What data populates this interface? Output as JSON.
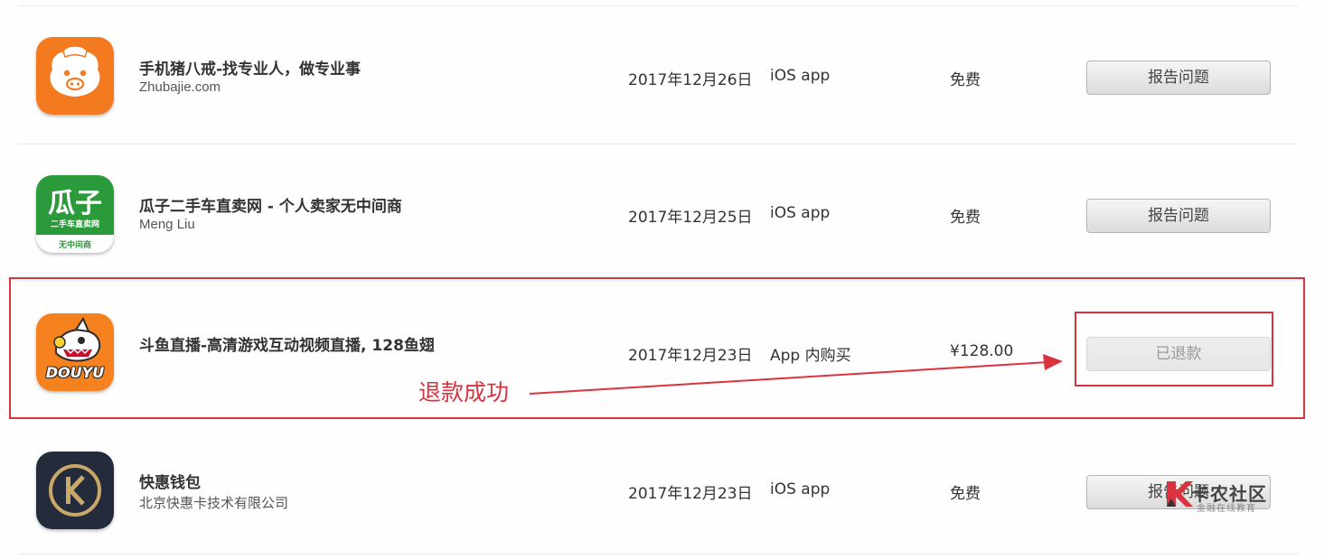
{
  "accent_color": "#d9333f",
  "rows": [
    {
      "icon": "zhubajie-pig-icon",
      "title": "手机猪八戒-找专业人，做专业事",
      "subtitle": "Zhubajie.com",
      "date": "2017年12月26日",
      "type": "iOS app",
      "price": "免费",
      "button": "报告问题"
    },
    {
      "icon": "guazi-logo-icon",
      "icon_text_main": "瓜子",
      "icon_text_line": "二手车直卖网",
      "icon_text_band": "无中间商",
      "title": "瓜子二手车直卖网 - 个人卖家无中间商",
      "subtitle": "Meng Liu",
      "date": "2017年12月25日",
      "type": "iOS app",
      "price": "免费",
      "button": "报告问题"
    },
    {
      "icon": "douyu-shark-icon",
      "icon_text": "DOUYU",
      "title": "斗鱼直播-高清游戏互动视频直播, 128鱼翅",
      "subtitle": "",
      "date": "2017年12月23日",
      "type": "App 内购买",
      "price": "¥128.00",
      "button": "已退款"
    },
    {
      "icon": "kuaihui-k-icon",
      "title": "快惠钱包",
      "subtitle": "北京快惠卡技术有限公司",
      "date": "2017年12月23日",
      "type": "iOS app",
      "price": "免费",
      "button": "报告问题"
    }
  ],
  "annotation": "退款成功",
  "watermark": {
    "title": "卡农社区",
    "subtitle": "金融在线教育"
  }
}
